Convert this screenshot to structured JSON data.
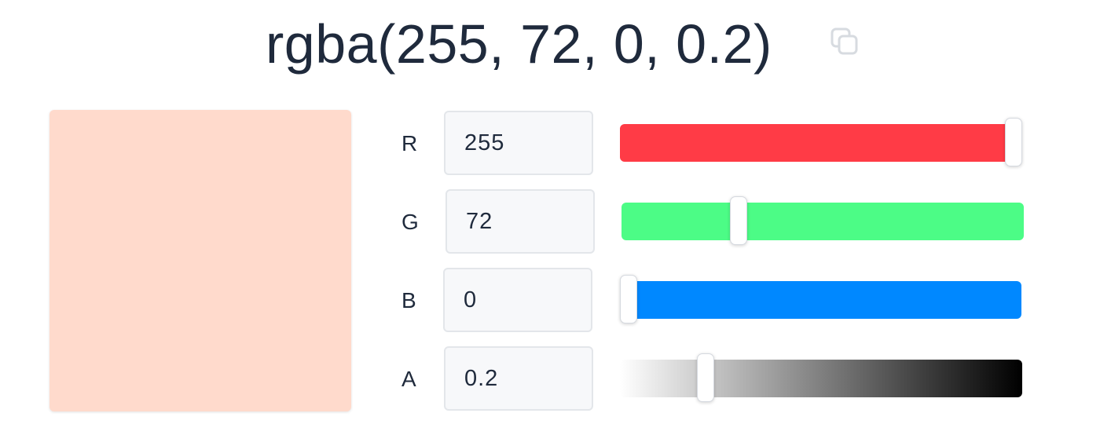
{
  "header": {
    "color_string": "rgba(255, 72, 0, 0.2)",
    "copy_icon": "copy-icon"
  },
  "preview": {
    "color": "rgba(255, 72, 0, 0.2)"
  },
  "channels": [
    {
      "label": "R",
      "value": "255",
      "max": 255,
      "track_color": "#ff3b46"
    },
    {
      "label": "G",
      "value": "72",
      "max": 255,
      "track_color": "#4cfc86"
    },
    {
      "label": "B",
      "value": "0",
      "max": 255,
      "track_color": "#0088ff"
    },
    {
      "label": "A",
      "value": "0.2",
      "max": 1,
      "track_gradient": [
        "#ffffff",
        "#000000"
      ]
    }
  ]
}
